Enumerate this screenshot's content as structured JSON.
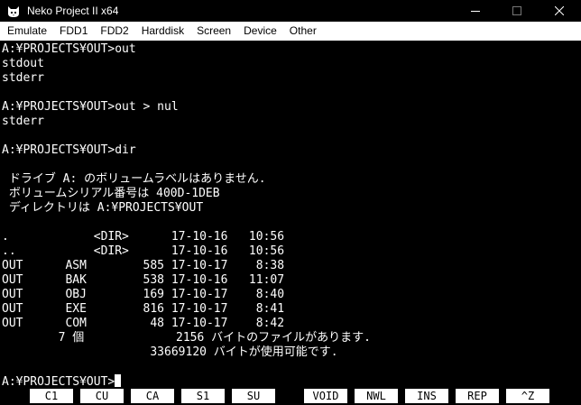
{
  "window": {
    "title": "Neko Project II x64",
    "icon": "cat-icon"
  },
  "menubar": {
    "items": [
      {
        "label": "Emulate"
      },
      {
        "label": "FDD1"
      },
      {
        "label": "FDD2"
      },
      {
        "label": "Harddisk"
      },
      {
        "label": "Screen"
      },
      {
        "label": "Device"
      },
      {
        "label": "Other"
      }
    ]
  },
  "terminal": {
    "lines": [
      "A:¥PROJECTS¥OUT>out",
      "stdout",
      "stderr",
      "",
      "A:¥PROJECTS¥OUT>out > nul",
      "stderr",
      "",
      "A:¥PROJECTS¥OUT>dir",
      "",
      " ドライブ A: のボリュームラベルはありません.",
      " ボリュームシリアル番号は 400D-1DEB",
      " ディレクトリは A:¥PROJECTS¥OUT",
      "",
      ".            <DIR>      17-10-16   10:56",
      "..           <DIR>      17-10-16   10:56",
      "OUT      ASM        585 17-10-17    8:38",
      "OUT      BAK        538 17-10-16   11:07",
      "OUT      OBJ        169 17-10-17    8:40",
      "OUT      EXE        816 17-10-17    8:41",
      "OUT      COM         48 17-10-17    8:42",
      "        7 個             2156 バイトのファイルがあります.",
      "                     33669120 バイトが使用可能です.",
      "",
      "A:¥PROJECTS¥OUT>"
    ]
  },
  "fkeys": [
    {
      "label": "C1"
    },
    {
      "label": "CU"
    },
    {
      "label": "CA"
    },
    {
      "label": "S1"
    },
    {
      "label": "SU"
    },
    {
      "label": "VOID"
    },
    {
      "label": "NWL"
    },
    {
      "label": "INS"
    },
    {
      "label": "REP"
    },
    {
      "label": "^Z"
    }
  ],
  "colors": {
    "background": "#000000",
    "text": "#ffffff",
    "menu_bg": "#ffffff",
    "fkey_bg": "#ffffff"
  }
}
